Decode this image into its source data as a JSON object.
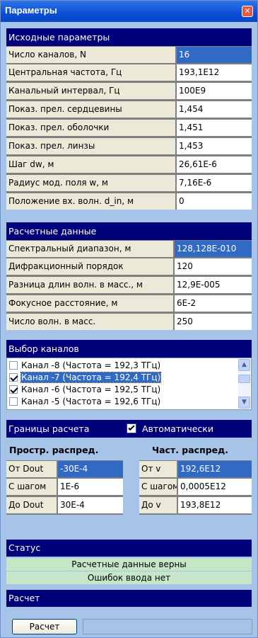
{
  "window": {
    "title": "Параметры",
    "close_icon": "close-icon"
  },
  "initial": {
    "header": "Исходные параметры",
    "rows": [
      {
        "label": "Число каналов, N",
        "value": "16"
      },
      {
        "label": "Центральная частота, Гц",
        "value": "193,1E12"
      },
      {
        "label": "Канальный интервал, Гц",
        "value": "100E9"
      },
      {
        "label": "Показ. прел. сердцевины",
        "value": "1,454"
      },
      {
        "label": "Показ. прел. оболочки",
        "value": "1,451"
      },
      {
        "label": "Показ. прел. линзы",
        "value": "1,453"
      },
      {
        "label": "Шаг dw, м",
        "value": "26,61E-6"
      },
      {
        "label": "Радиус мод. поля w, м",
        "value": "7,16E-6"
      },
      {
        "label": "Положение вх. волн. d_in, м",
        "value": "0"
      }
    ]
  },
  "calculated": {
    "header": "Расчетные данные",
    "rows": [
      {
        "label": "Спектральный диапазон, м",
        "value": "128,128E-010"
      },
      {
        "label": "Дифракционный порядок",
        "value": "120"
      },
      {
        "label": "Разница длин волн. в масс., м",
        "value": "12,9E-005"
      },
      {
        "label": "Фокусное расстояние, м",
        "value": "6E-2"
      },
      {
        "label": "Число волн. в масс.",
        "value": "250"
      }
    ]
  },
  "channels": {
    "header": "Выбор каналов",
    "items": [
      {
        "label": "Канал -8 (Частота = 192,3 ТГц)",
        "checked": false
      },
      {
        "label": "Канал -7 (Частота = 192,4 ТГц)",
        "checked": true
      },
      {
        "label": "Канал -6 (Частота = 192,5 ТГц)",
        "checked": true
      },
      {
        "label": "Канал -5 (Частота = 192,6 ТГц)",
        "checked": false
      }
    ]
  },
  "bounds": {
    "header": "Границы расчета",
    "auto_label": "Автоматически",
    "auto_checked": true,
    "spatial": {
      "title": "Простр. распред.",
      "rows": [
        {
          "label": "От Dout",
          "value": "-30E-4"
        },
        {
          "label": "С шагом",
          "value": "1E-6"
        },
        {
          "label": "До Dout",
          "value": "30E-4"
        }
      ]
    },
    "frequency": {
      "title": "Част. распред.",
      "rows": [
        {
          "label": "От v",
          "value": "192,6E12"
        },
        {
          "label": "С шагом",
          "value": "0,0005E12"
        },
        {
          "label": "До v",
          "value": "193,8E12"
        }
      ]
    }
  },
  "status": {
    "header": "Статус",
    "lines": [
      "Расчетные данные верны",
      "Ошибок ввода нет"
    ]
  },
  "calc": {
    "header": "Расчет",
    "button": "Расчет"
  }
}
